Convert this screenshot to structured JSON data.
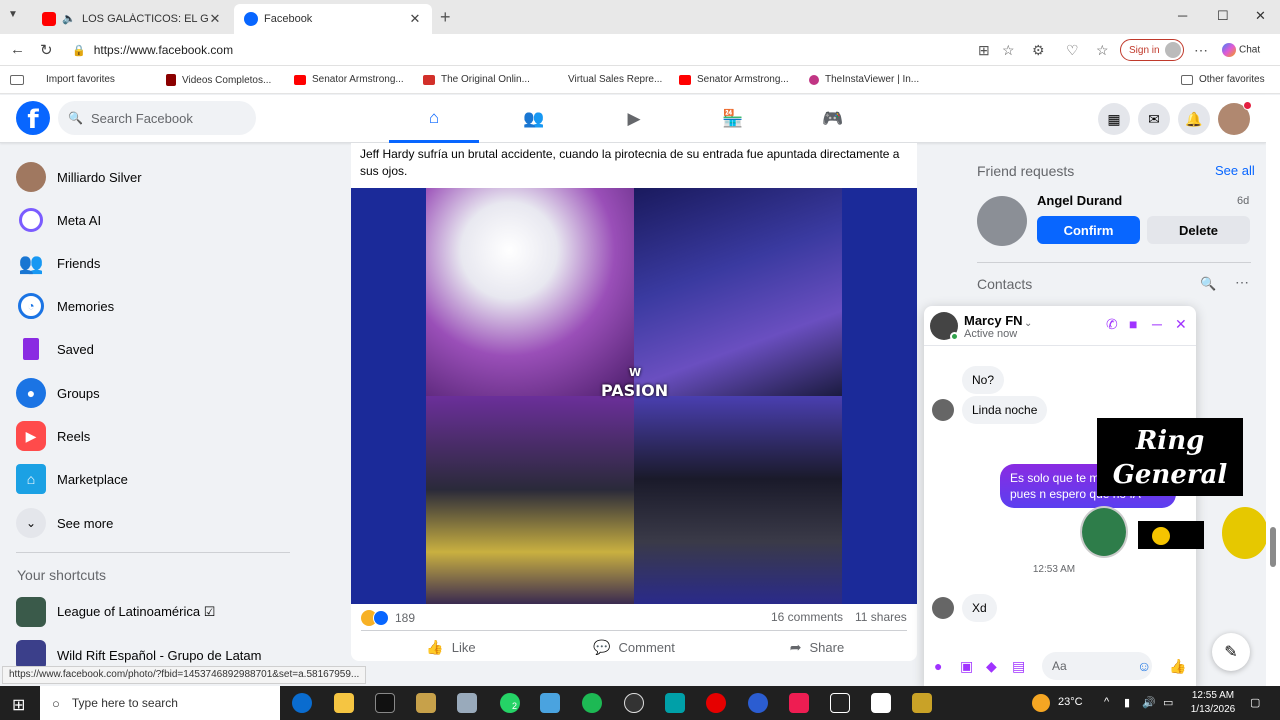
{
  "browser": {
    "tabs": [
      {
        "title": "LOS GALÁCTICOS: EL GRAN FINAL"
      },
      {
        "title": "Facebook"
      }
    ],
    "url": "https://www.facebook.com",
    "signin_label": "Sign in",
    "chat_label": "Chat",
    "bookmarks": [
      {
        "label": "Import favorites"
      },
      {
        "label": "Videos Completos..."
      },
      {
        "label": "Senator Armstrong..."
      },
      {
        "label": "The Original Onlin..."
      },
      {
        "label": "Virtual Sales Repre..."
      },
      {
        "label": "Senator Armstrong..."
      },
      {
        "label": "TheInstaViewer | In..."
      },
      {
        "label": "Other favorites"
      }
    ]
  },
  "fb": {
    "search_placeholder": "Search Facebook",
    "left_nav": [
      {
        "label": "Milliardo Silver"
      },
      {
        "label": "Meta AI"
      },
      {
        "label": "Friends"
      },
      {
        "label": "Memories"
      },
      {
        "label": "Saved"
      },
      {
        "label": "Groups"
      },
      {
        "label": "Reels"
      },
      {
        "label": "Marketplace"
      },
      {
        "label": "See more"
      }
    ],
    "shortcuts_heading": "Your shortcuts",
    "shortcuts": [
      {
        "label": "League of Latinoamérica ☑"
      },
      {
        "label": "Wild Rift Español - Grupo de Latam"
      }
    ],
    "post": {
      "text": "Jeff Hardy sufría un brutal accidente, cuando la pirotecnia de su entrada fue apuntada directamente a sus ojos.",
      "watermark": "PASION",
      "reactions_count": "189",
      "comments": "16 comments",
      "shares": "11 shares",
      "actions": {
        "like": "Like",
        "comment": "Comment",
        "share": "Share"
      }
    },
    "right": {
      "friend_requests_heading": "Friend requests",
      "see_all": "See all",
      "request": {
        "name": "Angel Durand",
        "age": "6d",
        "confirm": "Confirm",
        "delete": "Delete"
      },
      "contacts_heading": "Contacts"
    },
    "chat": {
      "name": "Marcy FN",
      "status": "Active now",
      "messages_in": [
        "No?",
        "Linda noche",
        "Xd"
      ],
      "message_out": "Es solo que te m bonita y pues n espero que no IA",
      "time": "12:53 AM",
      "input_placeholder": "Aa"
    },
    "overlay_logo_text": "Ring General"
  },
  "status_url": "https://www.facebook.com/photo/?fbid=1453746892988701&set=a.58167959...",
  "taskbar": {
    "search_placeholder": "Type here to search",
    "temperature": "23°C",
    "time": "12:55 AM",
    "date": "1/13/2026",
    "whatsapp_badge": "2"
  },
  "colors": {
    "fb_blue": "#0866ff",
    "chat_purple": "#7b2ff7"
  }
}
